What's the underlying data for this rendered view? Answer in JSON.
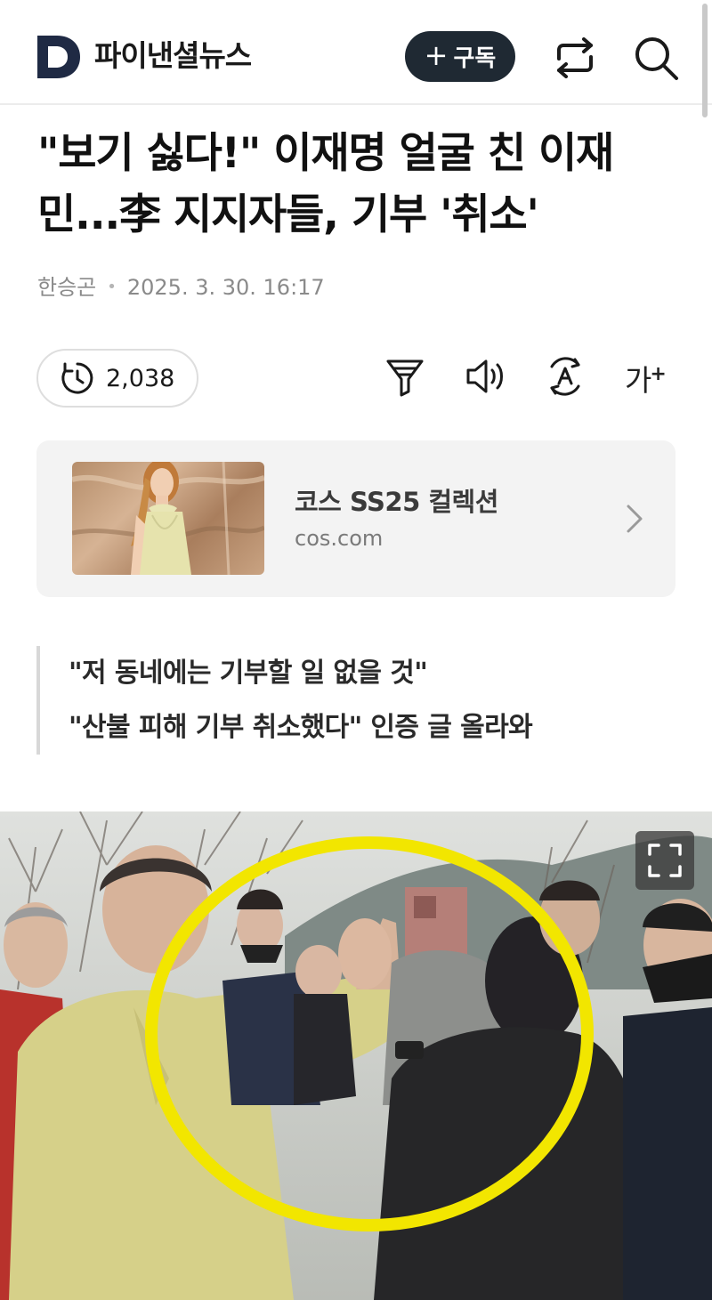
{
  "header": {
    "brand_name": "파이낸셜뉴스",
    "subscribe_label": "구독",
    "subscribe_icon": "plus-icon",
    "share_icon": "share-icon",
    "search_icon": "search-icon"
  },
  "article": {
    "headline": "\"보기 싫다!\" 이재명 얼굴 친 이재민...李 지지자들, 기부 '취소'",
    "author": "한승곤",
    "datetime": "2025. 3. 30. 16:17",
    "views": "2,038",
    "subheadings": [
      "\"저 동네에는 기부할 일 없을 것\"",
      "\"산불 피해 기부 취소했다\" 인증 글 올라와"
    ]
  },
  "toolbar": {
    "summary_icon": "filter-icon",
    "listen_icon": "speaker-icon",
    "translate_icon": "translate-icon",
    "font_size_label": "가",
    "font_size_plus": "+"
  },
  "ad": {
    "title": "코스 SS25 컬렉션",
    "domain": "cos.com"
  },
  "photo": {
    "expand_icon": "fullscreen-icon",
    "highlight_color": "#f2e600"
  },
  "colors": {
    "brand_navy": "#1f2a44",
    "subscribe_bg": "#1f2933",
    "meta_gray": "#8a8a8a"
  }
}
